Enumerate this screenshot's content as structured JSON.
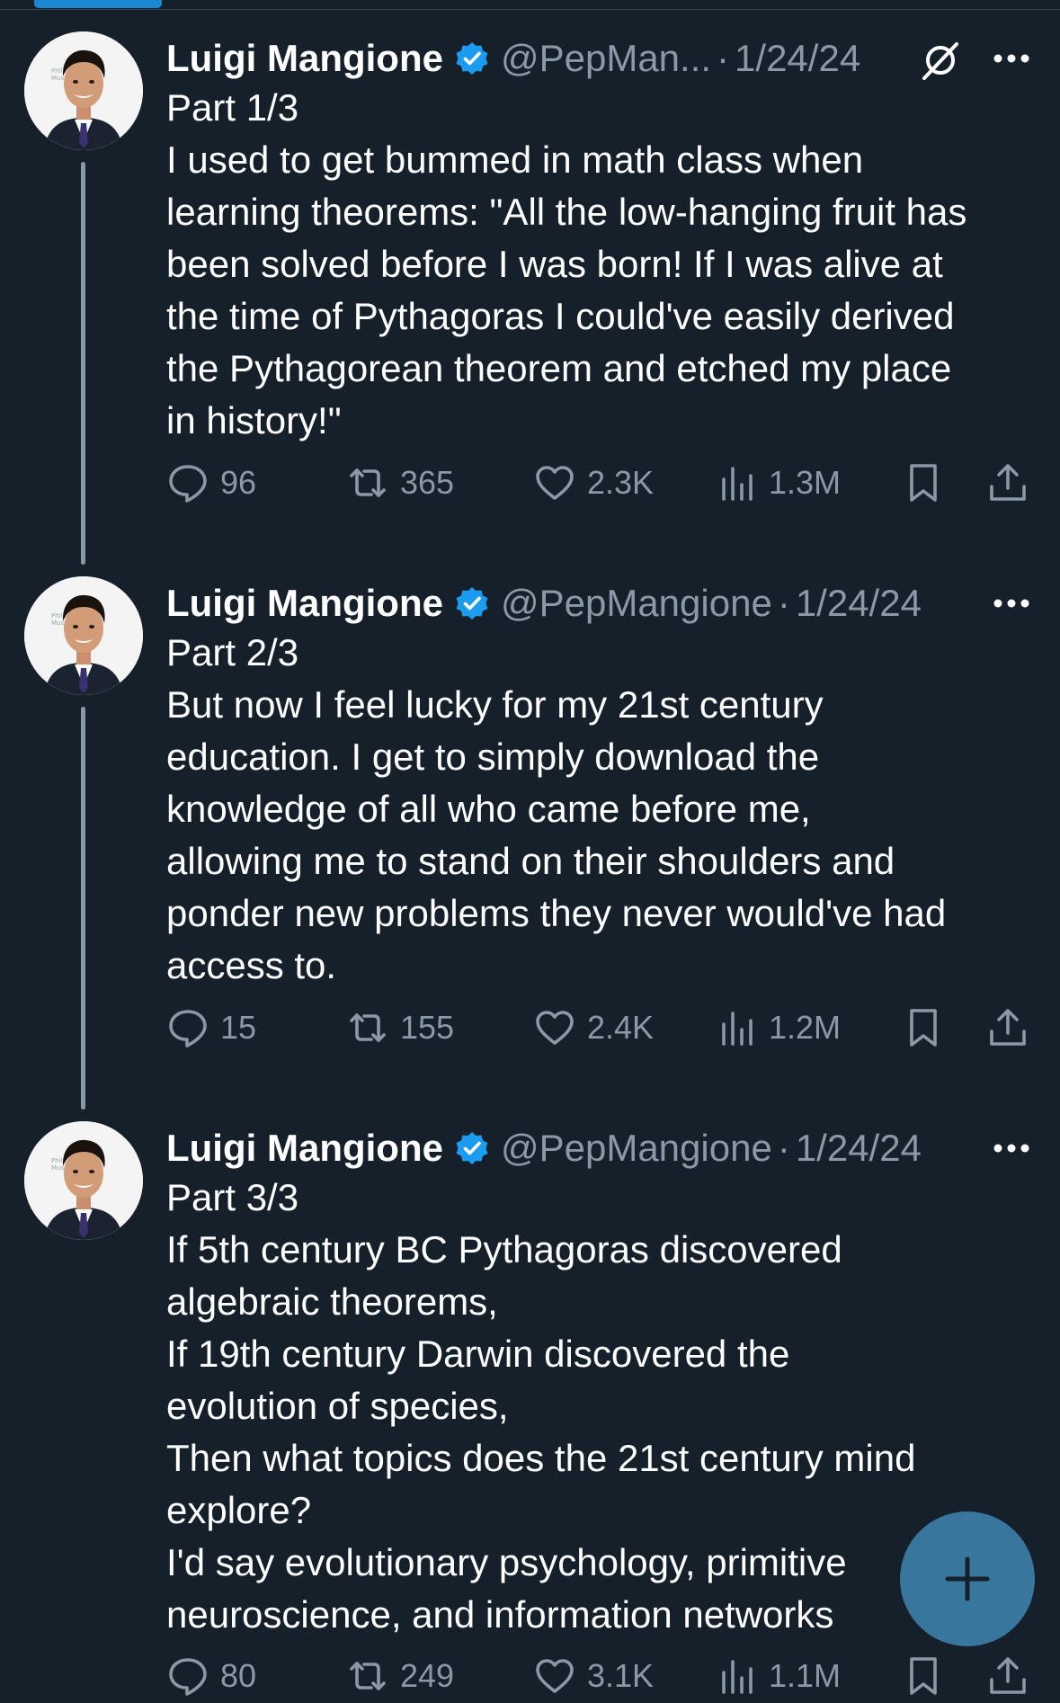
{
  "colors": {
    "background": "#15202b",
    "accent": "#1d9bf0",
    "muted": "#8b98a5"
  },
  "tweets": [
    {
      "name": "Luigi Mangione",
      "handle": "@PepMan...",
      "separator": "·",
      "date": "1/24/24",
      "lines": [
        "Part 1/3",
        "I used to get bummed in math class when",
        "learning theorems: \"All the low-hanging fruit has",
        "been solved before I was born! If I was alive at",
        "the time of Pythagoras I could've easily derived",
        "the Pythagorean theorem and etched my place",
        "in history!\""
      ],
      "replies": "96",
      "reposts": "365",
      "likes": "2.3K",
      "views": "1.3M"
    },
    {
      "name": "Luigi Mangione",
      "handle": "@PepMangione",
      "separator": "·",
      "date": "1/24/24",
      "lines": [
        "Part 2/3",
        "But now I feel lucky for my 21st century",
        "education. I get to simply download the",
        "knowledge of all who came before me,",
        "allowing me to stand on their shoulders and",
        "ponder new problems they never would've had",
        "access to."
      ],
      "replies": "15",
      "reposts": "155",
      "likes": "2.4K",
      "views": "1.2M"
    },
    {
      "name": "Luigi Mangione",
      "handle": "@PepMangione",
      "separator": "·",
      "date": "1/24/24",
      "lines": [
        "Part 3/3",
        "If 5th century BC Pythagoras discovered",
        "algebraic theorems,",
        "If 19th century Darwin discovered the",
        "evolution of species,",
        "Then what topics does the 21st century mind",
        "explore?",
        "I'd say evolutionary psychology, primitive",
        "neuroscience, and information networks"
      ],
      "replies": "80",
      "reposts": "249",
      "likes": "3.1K",
      "views": "1.1M"
    }
  ],
  "icons": {
    "verified": "verified-badge-icon",
    "grok": "grok-icon",
    "more": "more-icon",
    "reply": "reply-icon",
    "repost": "repost-icon",
    "like": "heart-icon",
    "views": "views-icon",
    "bookmark": "bookmark-icon",
    "share": "share-icon",
    "compose": "plus-icon"
  }
}
